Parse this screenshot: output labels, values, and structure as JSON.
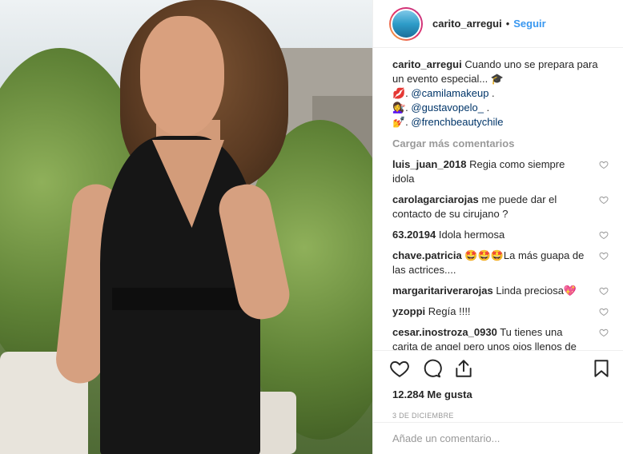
{
  "post": {
    "username": "carito_arregui",
    "follow_label": "Seguir",
    "separator": "•"
  },
  "caption": {
    "username": "carito_arregui",
    "text": "Cuando uno se prepara para un evento especial... 🎓",
    "line2_prefix": "💋. ",
    "line2_mention": "@camilamakeup",
    "line2_suffix": " .",
    "line3_prefix": "💇‍♀️. ",
    "line3_mention": "@gustavopelo_",
    "line3_suffix": " .",
    "line4_prefix": "💅. ",
    "line4_mention": "@frenchbeautychile"
  },
  "load_more_label": "Cargar más comentarios",
  "comments": [
    {
      "user": "luis_juan_2018",
      "text": "Regia como siempre idola"
    },
    {
      "user": "carolagarciarojas",
      "text": "me puede dar el contacto de su cirujano ?"
    },
    {
      "user": "63.20194",
      "text": "Idola hermosa"
    },
    {
      "user": "chave.patricia",
      "text": "🤩🤩🤩La más guapa de las actrices...."
    },
    {
      "user": "margaritariverarojas",
      "text": "Linda preciosa💖"
    },
    {
      "user": "yzoppi",
      "text": "Regía !!!!"
    },
    {
      "user": "cesar.inostroza_0930",
      "text": "Tu tienes una carita de angel pero unos ojos llenos de maldad.... Eso si perfecta angel"
    }
  ],
  "likes_label": "12.284 Me gusta",
  "date_label": "3 DE DICIEMBRE",
  "add_comment_placeholder": "Añade un comentario...",
  "icons": [
    "heart-icon",
    "comment-icon",
    "share-icon",
    "bookmark-icon"
  ],
  "colors": {
    "link": "#3897f0",
    "mention": "#003569",
    "muted": "#999999"
  }
}
